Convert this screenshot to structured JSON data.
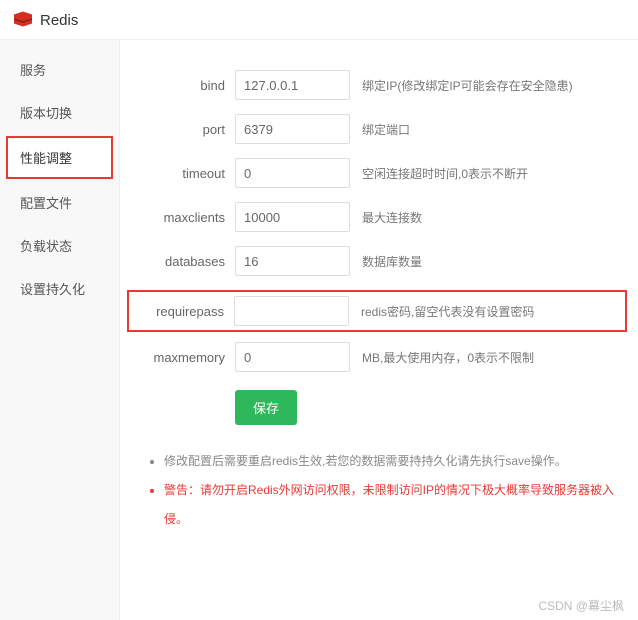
{
  "header": {
    "title": "Redis"
  },
  "sidebar": {
    "items": [
      {
        "label": "服务"
      },
      {
        "label": "版本切换"
      },
      {
        "label": "性能调整"
      },
      {
        "label": "配置文件"
      },
      {
        "label": "负载状态"
      },
      {
        "label": "设置持久化"
      }
    ]
  },
  "form": {
    "bind": {
      "label": "bind",
      "value": "127.0.0.1",
      "desc": "绑定IP(修改绑定IP可能会存在安全隐患)"
    },
    "port": {
      "label": "port",
      "value": "6379",
      "desc": "绑定端口"
    },
    "timeout": {
      "label": "timeout",
      "value": "0",
      "desc": "空闲连接超时时间,0表示不断开"
    },
    "maxclients": {
      "label": "maxclients",
      "value": "10000",
      "desc": "最大连接数"
    },
    "databases": {
      "label": "databases",
      "value": "16",
      "desc": "数据库数量"
    },
    "requirepass": {
      "label": "requirepass",
      "value": "",
      "desc": "redis密码,留空代表没有设置密码"
    },
    "maxmemory": {
      "label": "maxmemory",
      "value": "0",
      "desc": "MB,最大使用内存，0表示不限制"
    }
  },
  "buttons": {
    "save": "保存"
  },
  "notes": {
    "info": "修改配置后需要重启redis生效,若您的数据需要持持久化请先执行save操作。",
    "warn": "警告：请勿开启Redis外网访问权限，未限制访问IP的情况下极大概率导致服务器被入侵。"
  },
  "watermark": "CSDN @幕尘枫"
}
